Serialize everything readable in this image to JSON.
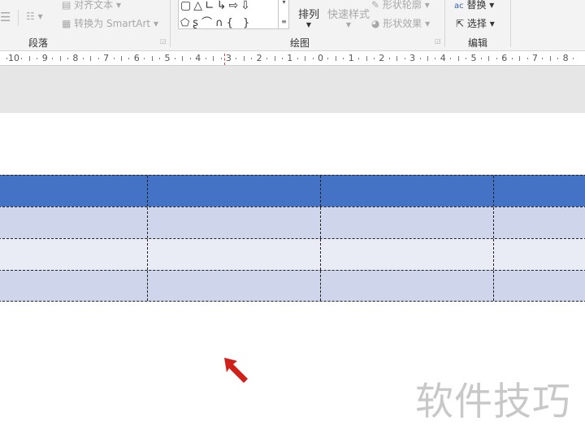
{
  "ribbon": {
    "paragraph": {
      "align_text": "对齐文本",
      "convert_smartart": "转换为 SmartArt",
      "group_label": "段落"
    },
    "drawing": {
      "arrange": "排列",
      "quick_styles": "快速样式",
      "shape_outline": "形状轮廓",
      "shape_effects": "形状效果",
      "group_label": "绘图"
    },
    "editing": {
      "replace": "替换",
      "select": "选择",
      "group_label": "编辑"
    }
  },
  "ruler": {
    "ticks": [
      "10",
      "9",
      "8",
      "7",
      "6",
      "5",
      "4",
      "3",
      "2",
      "1",
      "0",
      "1",
      "2",
      "3",
      "4",
      "5",
      "6",
      "7",
      "8"
    ]
  },
  "table": {
    "rows": [
      {
        "color": "#4472C4"
      },
      {
        "color": "#CFD5EA"
      },
      {
        "color": "#E9EBF5"
      },
      {
        "color": "#CFD5EA"
      }
    ],
    "columns": 4
  },
  "watermark": "软件技巧",
  "cursor_color": "#D0201A"
}
